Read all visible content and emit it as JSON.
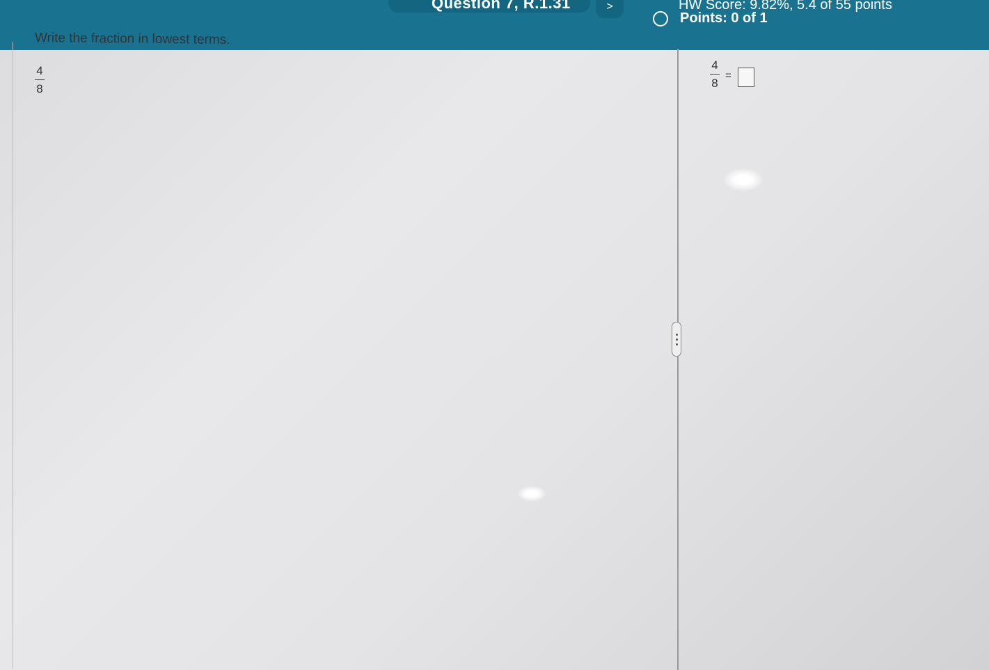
{
  "header": {
    "question_title": "Question 7, R.1.31",
    "next_label": ">",
    "score_line": "HW Score: 9.82%, 5.4 of 55 points",
    "points_label": "Points: 0 of 1"
  },
  "question": {
    "instruction": "Write the fraction in lowest terms.",
    "fraction": {
      "numerator": "4",
      "denominator": "8"
    }
  },
  "answer": {
    "fraction": {
      "numerator": "4",
      "denominator": "8"
    },
    "equals": "=",
    "input_value": ""
  },
  "colors": {
    "header_bg": "#19728f",
    "header_dark": "#146680",
    "text": "#333333"
  }
}
